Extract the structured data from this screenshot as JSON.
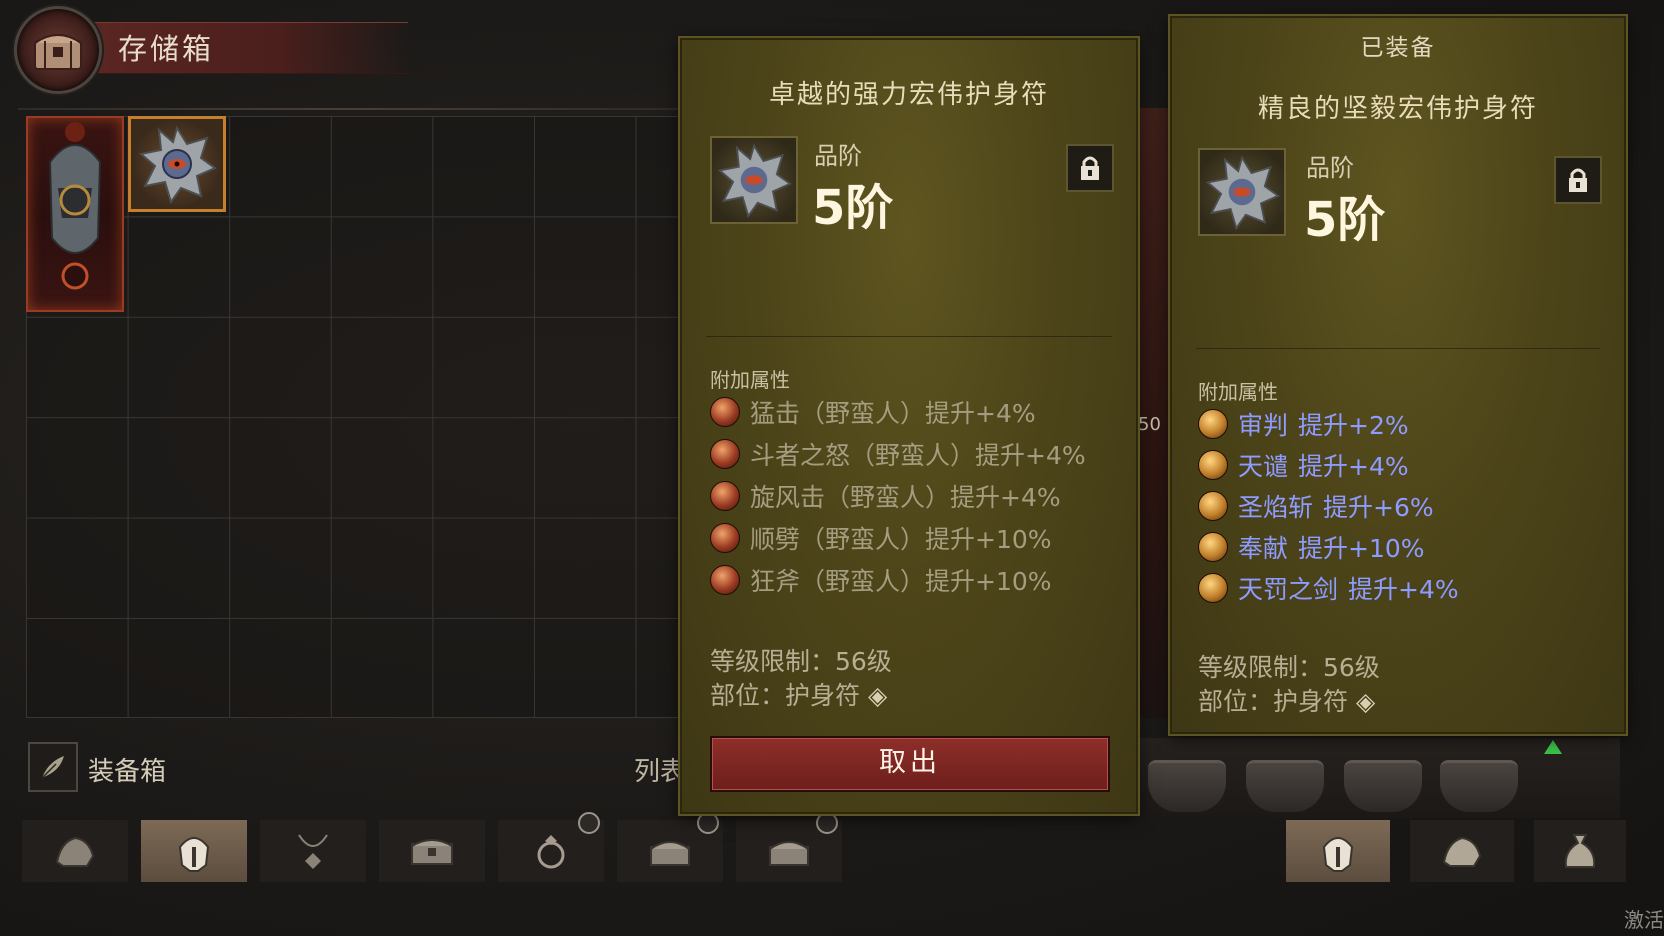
{
  "header": {
    "title": "存储箱",
    "emblem_icon": "chest-icon"
  },
  "stash": {
    "equipped_slot_icon": "helmet-icon",
    "selected_item_icon": "amulet-icon",
    "footer_box_label": "装备箱",
    "footer_box_icon": "feather-icon",
    "list_label": "列表"
  },
  "tabs": [
    {
      "icon": "gauntlet-icon",
      "active": false,
      "badge": false
    },
    {
      "icon": "helmet-icon",
      "active": true,
      "badge": false
    },
    {
      "icon": "necklace-icon",
      "active": false,
      "badge": false
    },
    {
      "icon": "chest-icon",
      "active": false,
      "badge": false
    },
    {
      "icon": "ring-icon",
      "active": false,
      "badge": true
    },
    {
      "icon": "treasure-icon",
      "active": false,
      "badge": true
    },
    {
      "icon": "treasure-icon",
      "active": false,
      "badge": true
    }
  ],
  "right_tabs": [
    {
      "icon": "helmet-icon",
      "active": true
    },
    {
      "icon": "gauntlet-icon",
      "active": false
    },
    {
      "icon": "bag-icon",
      "active": false
    }
  ],
  "tooltip_new": {
    "name": "卓越的强力宏伟护身符",
    "tier_label": "品阶",
    "tier_value": "5阶",
    "affix_title": "附加属性",
    "affixes": [
      {
        "text": "猛击（野蛮人）提升+4%",
        "icon": "bash-icon"
      },
      {
        "text": "斗者之怒（野蛮人）提升+4%",
        "icon": "rage-icon"
      },
      {
        "text": "旋风击（野蛮人）提升+4%",
        "icon": "whirlwind-icon"
      },
      {
        "text": "顺劈（野蛮人）提升+10%",
        "icon": "cleave-icon"
      },
      {
        "text": "狂斧（野蛮人）提升+10%",
        "icon": "axe-icon"
      }
    ],
    "level_req": "等级限制：56级",
    "slot": "部位：护身符",
    "action_button": "取出"
  },
  "tooltip_equipped": {
    "header": "已装备",
    "name": "精良的坚毅宏伟护身符",
    "tier_label": "品阶",
    "tier_value": "5阶",
    "affix_title": "附加属性",
    "affixes": [
      {
        "skill": "审判",
        "bonus": "提升+2%",
        "icon": "judgment-icon"
      },
      {
        "skill": "天谴",
        "bonus": "提升+4%",
        "icon": "condemn-icon"
      },
      {
        "skill": "圣焰斩",
        "bonus": "提升+6%",
        "icon": "flame-slash-icon"
      },
      {
        "skill": "奉献",
        "bonus": "提升+10%",
        "icon": "consecration-icon"
      },
      {
        "skill": "天罚之剑",
        "bonus": "提升+4%",
        "icon": "sword-icon"
      }
    ],
    "level_req": "等级限制：56级",
    "slot": "部位：护身符"
  },
  "scene": {
    "side_number": "50"
  },
  "watermark": "激活",
  "colors": {
    "affix_active": "#8e9bff",
    "affix_inactive": "#a49d80",
    "panel": "#4d4519",
    "button": "#8e2f2a"
  }
}
